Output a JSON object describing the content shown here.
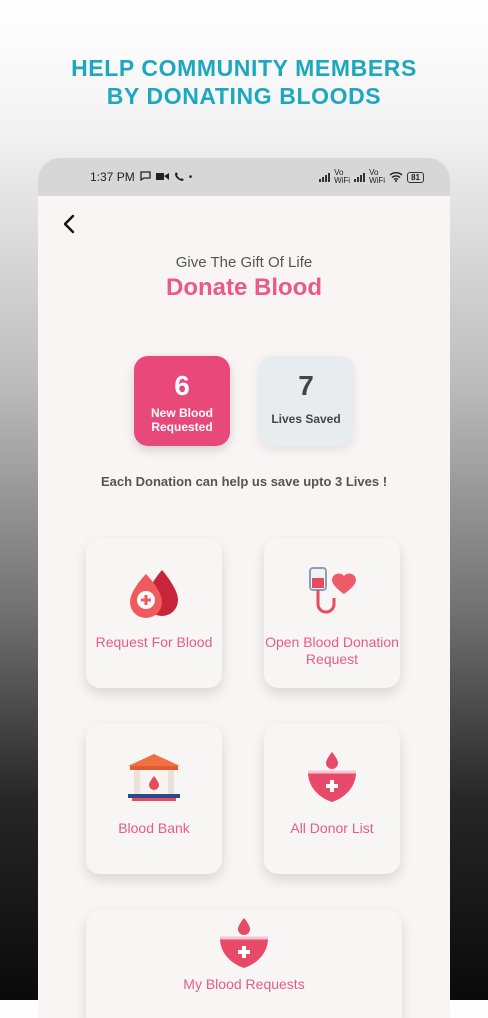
{
  "headline": {
    "line1": "HELP COMMUNITY MEMBERS",
    "line2": "BY DONATING BLOODS"
  },
  "status_bar": {
    "time": "1:37 PM",
    "battery": "81",
    "wifi_label1": "Vo WiFi",
    "wifi_label2": "Vo WiFi"
  },
  "screen": {
    "subtitle": "Give The Gift Of Life",
    "title": "Donate Blood",
    "stats": [
      {
        "value": "6",
        "label": "New Blood Requested"
      },
      {
        "value": "7",
        "label": "Lives Saved"
      }
    ],
    "note": "Each Donation can help us save upto 3 Lives !",
    "cards": [
      {
        "label": "Request For Blood",
        "icon": "blood-drop-icon"
      },
      {
        "label": "Open Blood Donation Request",
        "icon": "blood-bag-heart-icon"
      },
      {
        "label": "Blood Bank",
        "icon": "blood-bank-building-icon"
      },
      {
        "label": "All Donor List",
        "icon": "heart-drop-icon"
      },
      {
        "label": "My Blood Requests",
        "icon": "heart-drop-icon"
      }
    ]
  },
  "colors": {
    "accent": "#e85a8a",
    "headline": "#1ea8bf",
    "pink_card": "#e8487a"
  }
}
